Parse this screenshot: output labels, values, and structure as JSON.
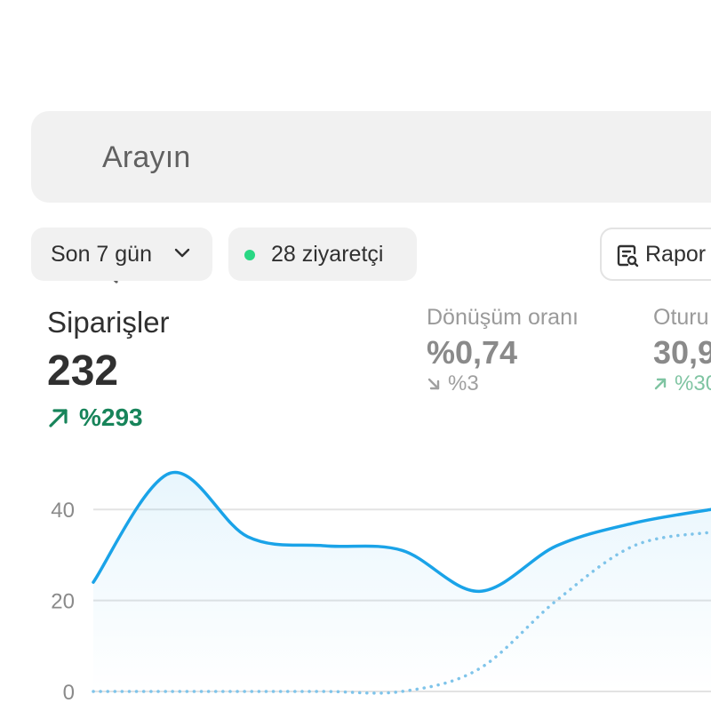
{
  "search": {
    "placeholder": "Arayın"
  },
  "filters": {
    "date_range": "Son 7 gün",
    "visitors": "28 ziyaretçi",
    "visitors_dot_color": "#29d783"
  },
  "report_button": {
    "label": "Rapor",
    "icon": "report-search-icon"
  },
  "metrics": {
    "primary": {
      "title": "Siparişler",
      "value": "232",
      "change": "%293",
      "direction": "up",
      "color": "#17845a"
    },
    "conversion": {
      "title": "Dönüşüm oranı",
      "value": "%0,74",
      "change": "%3",
      "direction": "down"
    },
    "sessions": {
      "title": "Oturu",
      "value": "30,9",
      "change": "%30",
      "direction": "up"
    }
  },
  "chart_data": {
    "type": "line",
    "y_ticks": [
      "0",
      "20",
      "40"
    ],
    "ylim": [
      0,
      50
    ],
    "grid": true,
    "colors": {
      "current": "#1aa3e8",
      "previous": "#7fc4ea"
    },
    "series": [
      {
        "values": [
          24,
          48,
          34,
          32,
          31,
          22,
          32,
          37,
          40
        ]
      },
      {
        "values": [
          0,
          0,
          0,
          0,
          0,
          5,
          20,
          32,
          35
        ],
        "style": "dotted"
      }
    ]
  }
}
